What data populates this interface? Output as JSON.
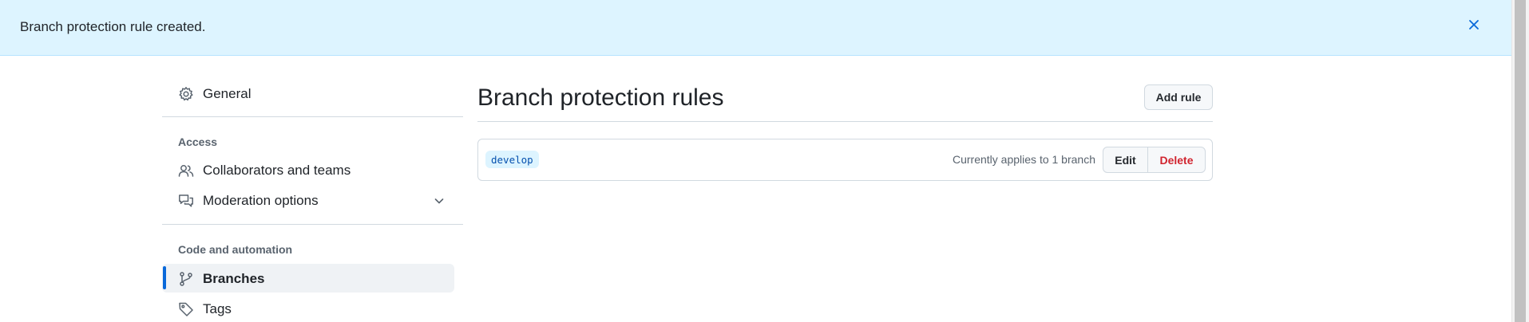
{
  "flash": {
    "message": "Branch protection rule created.",
    "close_icon": "x-icon"
  },
  "sidebar": {
    "general": {
      "label": "General",
      "icon": "gear-icon"
    },
    "sections": [
      {
        "title": "Access"
      },
      {
        "title": "Code and automation"
      }
    ],
    "items": [
      {
        "label": "Collaborators and teams",
        "icon": "people-icon"
      },
      {
        "label": "Moderation options",
        "icon": "comment-discussion-icon"
      },
      {
        "label": "Branches",
        "icon": "git-branch-icon",
        "selected": true
      },
      {
        "label": "Tags",
        "icon": "tag-icon"
      }
    ]
  },
  "main": {
    "title": "Branch protection rules",
    "add_rule_label": "Add rule",
    "rules": [
      {
        "branch": "develop",
        "applies": "Currently applies to 1 branch",
        "edit_label": "Edit",
        "delete_label": "Delete"
      }
    ]
  },
  "colors": {
    "flash_bg": "#ddf4ff",
    "accent": "#0969da",
    "danger": "#d1242f"
  }
}
